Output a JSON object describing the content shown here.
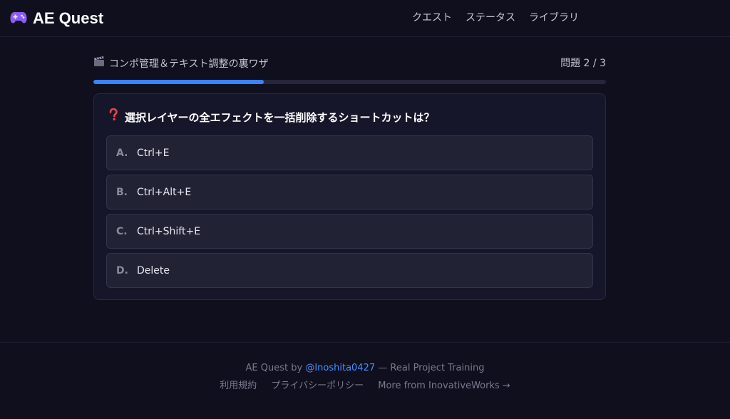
{
  "header": {
    "logo_text": "AE Quest",
    "logo_icon": "gamepad-icon",
    "nav": [
      "クエスト",
      "ステータス",
      "ライブラリ"
    ]
  },
  "quiz": {
    "title": "コンポ管理＆テキスト調整の裏ワザ",
    "title_icon": "clapperboard-icon",
    "counter": "問題 2 / 3",
    "progress_fraction": 0.333,
    "question_icon": "question-mark-icon",
    "question": "選択レイヤーの全エフェクトを一括削除するショートカットは？",
    "options": [
      {
        "letter": "A.",
        "text": "Ctrl+E"
      },
      {
        "letter": "B.",
        "text": "Ctrl+Alt+E"
      },
      {
        "letter": "C.",
        "text": "Ctrl+Shift+E"
      },
      {
        "letter": "D.",
        "text": "Delete"
      }
    ]
  },
  "footer": {
    "credit_prefix": "AE Quest by ",
    "credit_handle": "@Inoshita0427",
    "credit_suffix": " — Real Project Training",
    "links": [
      "利用規約",
      "プライバシーポリシー",
      "More from InovativeWorks →"
    ]
  },
  "colors": {
    "accent": "#3b82f6",
    "link": "#4a8eff",
    "background": "#0f0f1e",
    "card": "#16162a",
    "option": "#222235"
  }
}
